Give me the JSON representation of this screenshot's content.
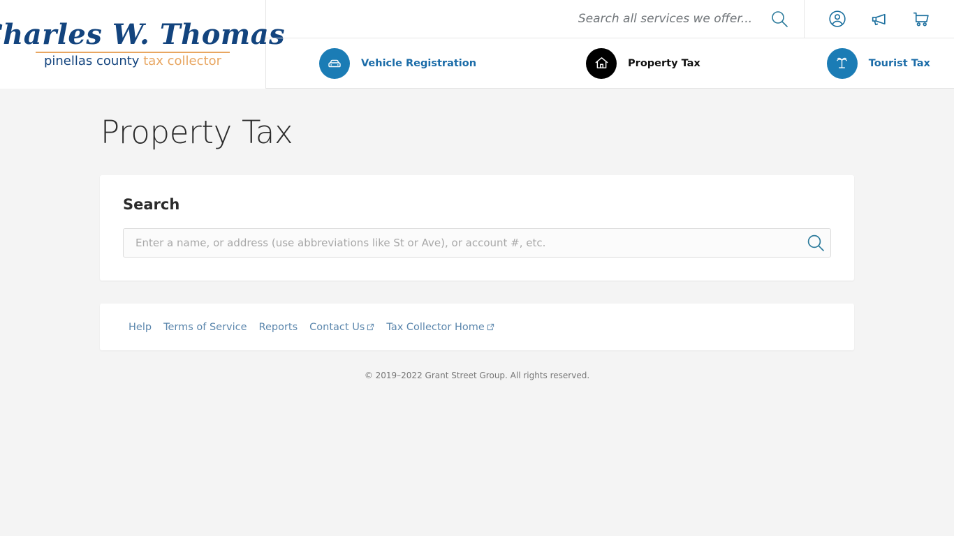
{
  "brand": {
    "script_name": "Charles W. Thomas",
    "sub_left": "pinellas county",
    "sub_right": "tax collector"
  },
  "header": {
    "global_search_placeholder": "Search all services we offer...",
    "icons": {
      "account": "account-circle-icon",
      "announcements": "megaphone-icon",
      "cart": "shopping-cart-icon"
    },
    "nav": [
      {
        "label": "Vehicle Registration",
        "icon": "car-icon",
        "active": false
      },
      {
        "label": "Property Tax",
        "icon": "house-icon",
        "active": true
      },
      {
        "label": "Tourist Tax",
        "icon": "palm-tree-icon",
        "active": false
      }
    ]
  },
  "page": {
    "title": "Property Tax"
  },
  "search": {
    "heading": "Search",
    "value": "",
    "placeholder": "Enter a name, or address (use abbreviations like St or Ave), or account #, etc.",
    "button_icon": "search-icon"
  },
  "footer": {
    "links": [
      {
        "label": "Help",
        "external": false
      },
      {
        "label": "Terms of Service",
        "external": false
      },
      {
        "label": "Reports",
        "external": false
      },
      {
        "label": "Contact Us",
        "external": true
      },
      {
        "label": "Tax Collector Home",
        "external": true
      }
    ],
    "copyright": "© 2019–2022 Grant Street Group. All rights reserved."
  },
  "colors": {
    "brand_navy": "#13447e",
    "brand_orange": "#e8a661",
    "accent_blue": "#1b7cb5",
    "active_black": "#000000",
    "link_blue": "#5c87ad",
    "page_bg": "#f4f4f4"
  }
}
